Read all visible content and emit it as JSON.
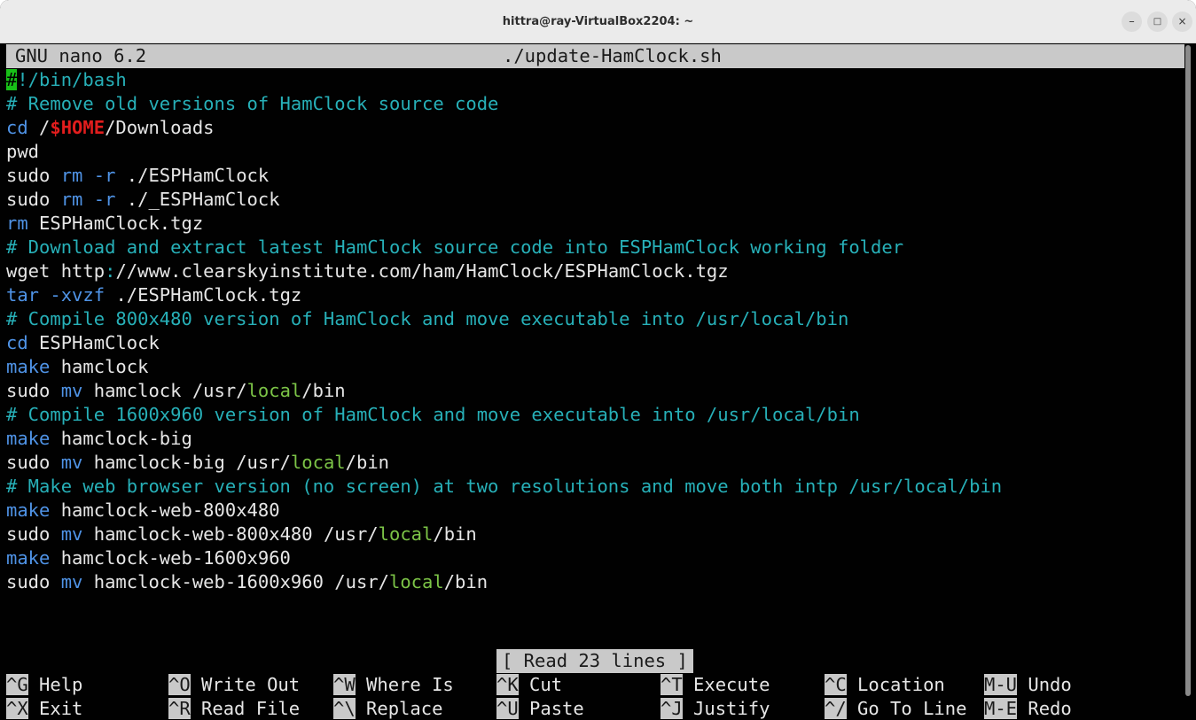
{
  "window": {
    "title": "hittra@ray-VirtualBox2204: ~",
    "buttons": {
      "minimize": "–",
      "maximize": "□",
      "close": "×"
    }
  },
  "nano": {
    "version": "GNU nano 6.2",
    "filename": "./update-HamClock.sh",
    "status": "[ Read 23 lines ]"
  },
  "file_lines": [
    "#!/bin/bash",
    "# Remove old versions of HamClock source code",
    "cd /$HOME/Downloads",
    "pwd",
    "sudo rm -r ./ESPHamClock",
    "sudo rm -r ./_ESPHamClock",
    "rm ESPHamClock.tgz",
    "# Download and extract latest HamClock source code into ESPHamClock working folder",
    "wget http://www.clearskyinstitute.com/ham/HamClock/ESPHamClock.tgz",
    "tar -xvzf ./ESPHamClock.tgz",
    "# Compile 800x480 version of HamClock and move executable into /usr/local/bin",
    "cd ESPHamClock",
    "make hamclock",
    "sudo mv hamclock /usr/local/bin",
    "# Compile 1600x960 version of HamClock and move executable into /usr/local/bin",
    "make hamclock-big",
    "sudo mv hamclock-big /usr/local/bin",
    "# Make web browser version (no screen) at two resolutions and move both intp /usr/local/bin",
    "make hamclock-web-800x480",
    "sudo mv hamclock-web-800x480 /usr/local/bin",
    "make hamclock-web-1600x960",
    "sudo mv hamclock-web-1600x960 /usr/local/bin"
  ],
  "shortcuts": [
    {
      "key": "^G",
      "label": "Help"
    },
    {
      "key": "^O",
      "label": "Write Out"
    },
    {
      "key": "^W",
      "label": "Where Is"
    },
    {
      "key": "^K",
      "label": "Cut"
    },
    {
      "key": "^T",
      "label": "Execute"
    },
    {
      "key": "^C",
      "label": "Location"
    },
    {
      "key": "M-U",
      "label": "Undo"
    },
    {
      "key": "^X",
      "label": "Exit"
    },
    {
      "key": "^R",
      "label": "Read File"
    },
    {
      "key": "^\\",
      "label": "Replace"
    },
    {
      "key": "^U",
      "label": "Paste"
    },
    {
      "key": "^J",
      "label": "Justify"
    },
    {
      "key": "^/",
      "label": "Go To Line"
    },
    {
      "key": "M-E",
      "label": "Redo"
    }
  ],
  "colors": {
    "terminal_bg": "#010101",
    "text": "#e6e6e6",
    "comment": "#27b0b8",
    "keyword": "#4f93e6",
    "variable": "#e21d1d",
    "path_local": "#7cc447",
    "cursor": "#18c018",
    "bar": "#c9c9c9"
  }
}
